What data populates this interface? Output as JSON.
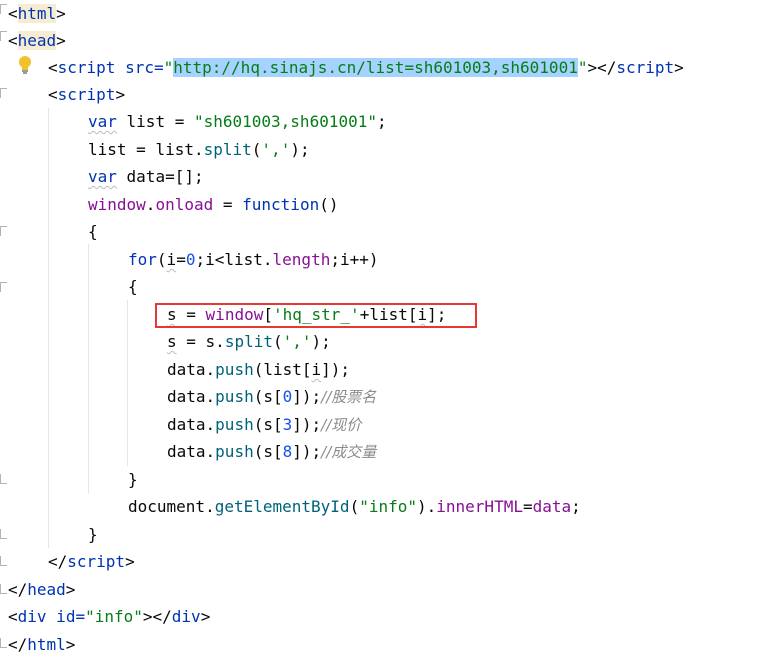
{
  "code": {
    "l1": {
      "open": "<",
      "tag": "html",
      "close": ">"
    },
    "l2": {
      "open": "<",
      "tag": "head",
      "close": ">"
    },
    "l3": {
      "open": "<",
      "tag": "script",
      "attr": " src=",
      "quote1": "\"",
      "url": "http://hq.sinajs.cn/list=sh601003,sh601001",
      "quote2": "\"",
      "close": "></",
      "tag2": "script",
      "end": ">"
    },
    "l4": {
      "open": "<",
      "tag": "script",
      "close": ">"
    },
    "l5": {
      "kw": "var",
      "name": " list = ",
      "str": "\"sh601003,sh601001\"",
      "end": ";"
    },
    "l6": {
      "a": "list",
      "b": " = ",
      "c": "list",
      "d": ".",
      "fn": "split",
      "e": "(",
      "str": "','",
      "f": ");"
    },
    "l7": {
      "kw": "var",
      "rest": " data=[];"
    },
    "l8": {
      "a": "window",
      "b": ".",
      "prop": "onload",
      "c": " = ",
      "kw": "function",
      "d": "()"
    },
    "l9": {
      "text": "{"
    },
    "l10": {
      "kw": "for",
      "a": "(",
      "i1": "i",
      "b": "=",
      "num": "0",
      "c": ";i<list.",
      "prop": "length",
      "d": ";i++)"
    },
    "l11": {
      "text": "{"
    },
    "l12": {
      "s": "s",
      "a": " = ",
      "w": "window",
      "b": "[",
      "str": "'hq_str_'",
      "c": "+list[",
      "i": "i",
      "d": "];"
    },
    "l13": {
      "s": "s",
      "a": " = s.",
      "fn": "split",
      "b": "(",
      "str": "','",
      "c": ");"
    },
    "l14": {
      "a": "data.",
      "fn": "push",
      "b": "(list[",
      "i": "i",
      "c": "]);"
    },
    "l15": {
      "a": "data.",
      "fn": "push",
      "b": "(s[",
      "num": "0",
      "c": "]);",
      "cm": "//股票名"
    },
    "l16": {
      "a": "data.",
      "fn": "push",
      "b": "(s[",
      "num": "3",
      "c": "]);",
      "cm": "//现价"
    },
    "l17": {
      "a": "data.",
      "fn": "push",
      "b": "(s[",
      "num": "8",
      "c": "]);",
      "cm": "//成交量"
    },
    "l18": {
      "text": "}"
    },
    "l19": {
      "a": "document.",
      "fn": "getElementById",
      "b": "(",
      "str": "\"info\"",
      "c": ").",
      "prop": "innerHTML",
      "d": "=",
      "e": "data",
      "f": ";"
    },
    "l20": {
      "text": "}"
    },
    "l21": {
      "open": "</",
      "tag": "script",
      "close": ">"
    },
    "l22": {
      "open": "</",
      "tag": "head",
      "close": ">"
    },
    "l23": {
      "open": "<",
      "tag": "div",
      "attr": " id=",
      "str": "\"info\"",
      "close": "></",
      "tag2": "div",
      "end": ">"
    },
    "l24": {
      "open": "</",
      "tag": "html",
      "close": ">"
    }
  },
  "icons": {
    "bulb": "lightbulb-icon",
    "fold": "fold-marker-icon"
  },
  "colors": {
    "highlight_box": "#e53935",
    "tag": "#0033b3",
    "string": "#067d17",
    "selection": "#a6d2ff"
  }
}
